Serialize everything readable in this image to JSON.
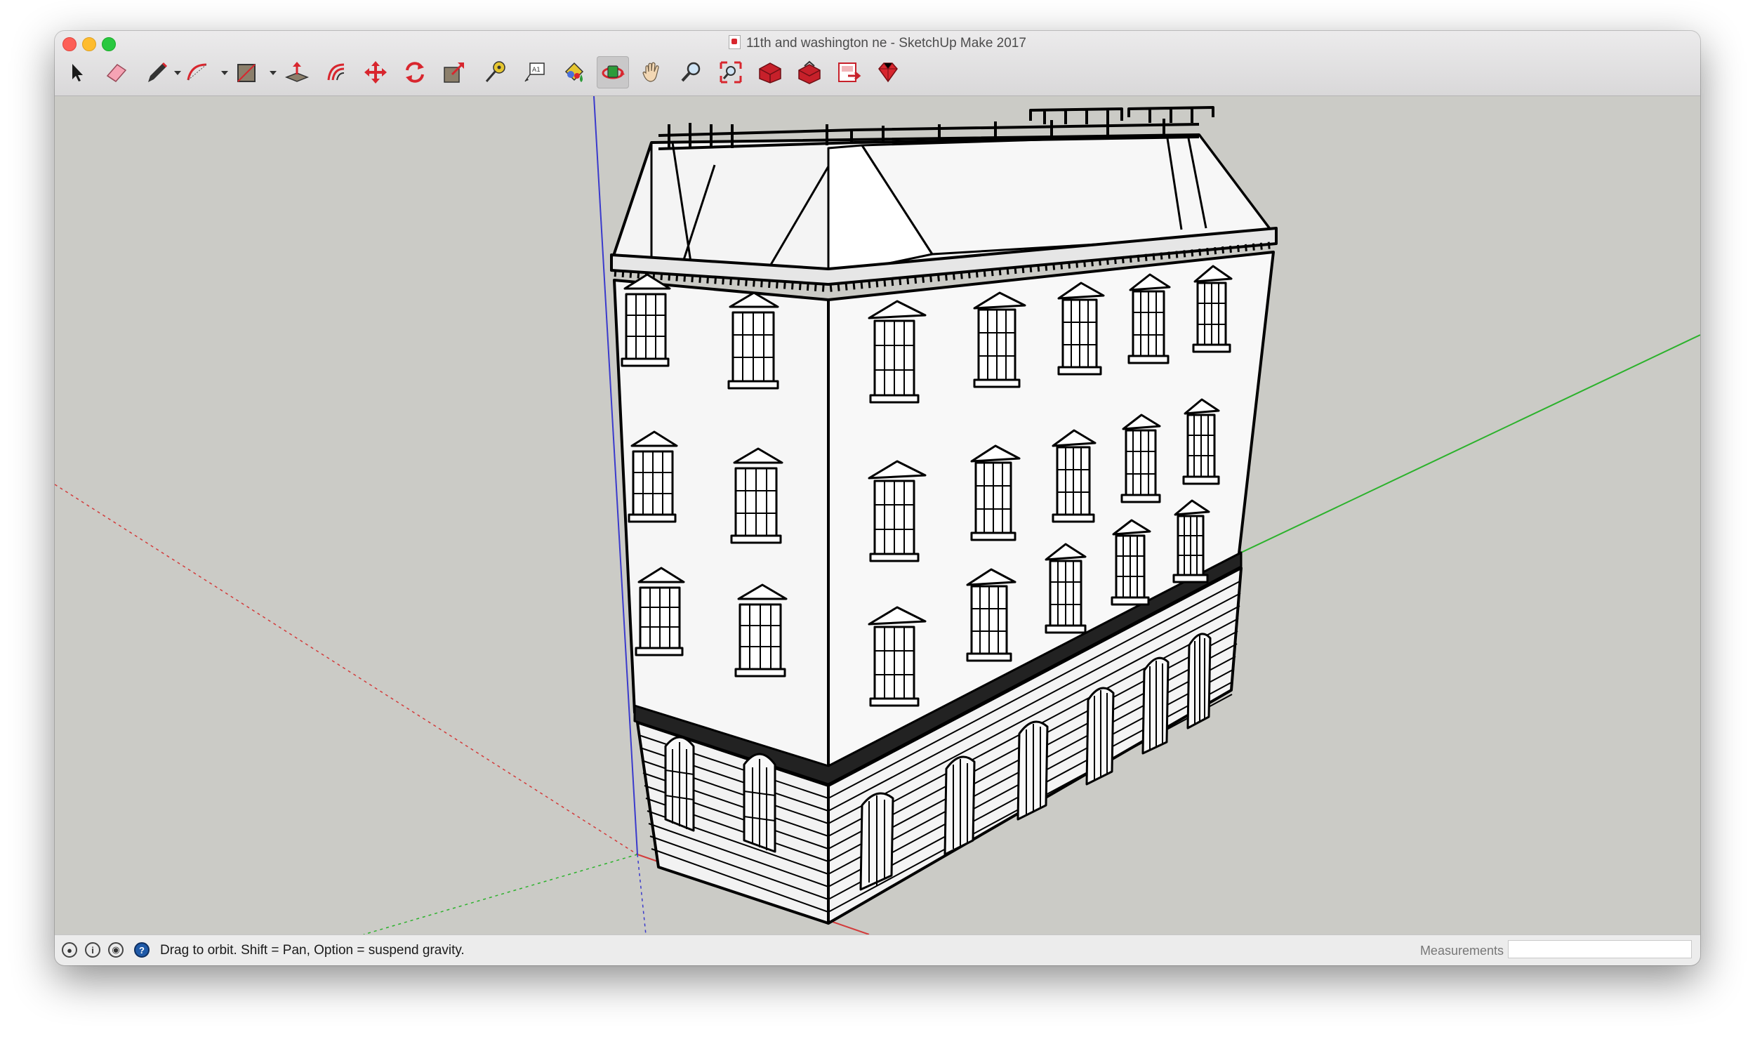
{
  "window": {
    "title": "11th and washington ne - SketchUp Make 2017"
  },
  "toolbar": {
    "tools": [
      {
        "name": "select-tool",
        "icon": "arrow-icon"
      },
      {
        "name": "eraser-tool",
        "icon": "eraser-icon"
      },
      {
        "name": "line-tool",
        "icon": "pencil-icon",
        "dropdown": true
      },
      {
        "name": "arc-tool",
        "icon": "arc-icon",
        "dropdown": true
      },
      {
        "name": "rectangle-tool",
        "icon": "rectangle-icon",
        "dropdown": true
      },
      {
        "name": "push-pull-tool",
        "icon": "push-pull-icon"
      },
      {
        "name": "offset-tool",
        "icon": "offset-icon"
      },
      {
        "name": "move-tool",
        "icon": "move-icon"
      },
      {
        "name": "rotate-tool",
        "icon": "rotate-icon"
      },
      {
        "name": "scale-tool",
        "icon": "scale-icon"
      },
      {
        "name": "tape-measure-tool",
        "icon": "tape-measure-icon"
      },
      {
        "name": "text-tool",
        "icon": "text-icon"
      },
      {
        "name": "paint-bucket-tool",
        "icon": "paint-bucket-icon"
      },
      {
        "name": "orbit-tool",
        "icon": "orbit-icon",
        "active": true
      },
      {
        "name": "pan-tool",
        "icon": "hand-icon"
      },
      {
        "name": "zoom-tool",
        "icon": "magnifier-icon"
      },
      {
        "name": "zoom-extents-tool",
        "icon": "zoom-extents-icon"
      },
      {
        "name": "3d-warehouse-tool",
        "icon": "warehouse-icon"
      },
      {
        "name": "extension-warehouse-tool",
        "icon": "extension-icon"
      },
      {
        "name": "send-to-layout-tool",
        "icon": "layout-icon"
      },
      {
        "name": "extension-store-tool",
        "icon": "ruby-icon"
      }
    ]
  },
  "status": {
    "hint": "Drag to orbit. Shift = Pan, Option = suspend gravity.",
    "measurements_label": "Measurements",
    "measurements_value": ""
  },
  "colors": {
    "viewport_bg": "#cbcbc6",
    "axis_red": "#d33b3b",
    "axis_green": "#2cb22c",
    "axis_blue": "#3a3acc",
    "tool_red": "#d8262e"
  }
}
